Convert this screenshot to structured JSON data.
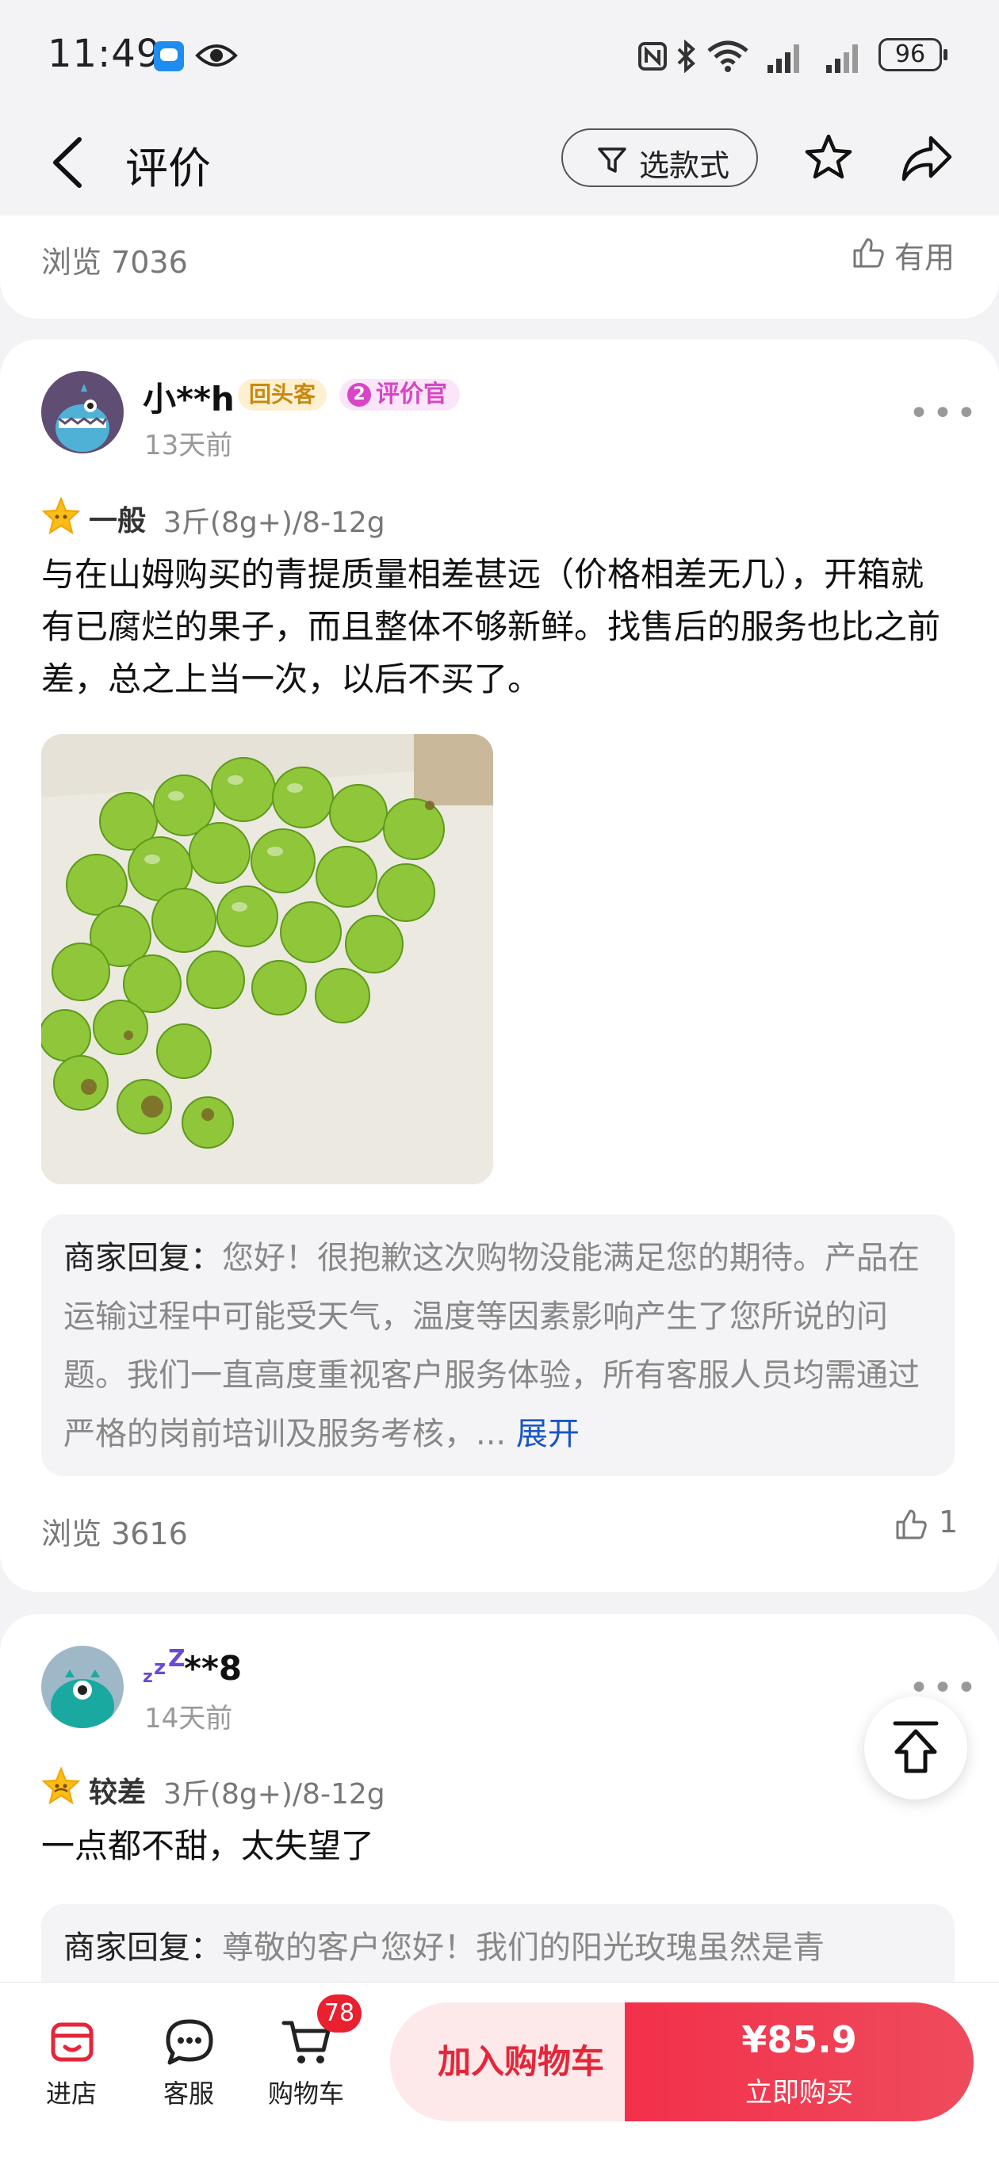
{
  "status_bar": {
    "time": "11:49",
    "battery": "96"
  },
  "header": {
    "title": "评价",
    "filter_label": "选款式"
  },
  "top_card": {
    "views": "浏览 7036",
    "helpful_label": "有用"
  },
  "review1": {
    "username": "小**h",
    "badge_returning": "回头客",
    "badge_reviewer": "评价官",
    "time_ago": "13天前",
    "rating_label": "一般",
    "spec": "3斤(8g+)/8-12g",
    "text": "与在山姆购买的青提质量相差甚远（价格相差无几），开箱就有已腐烂的果子，而且整体不够新鲜。找售后的服务也比之前差，总之上当一次，以后不买了。",
    "reply_label": "商家回复：",
    "reply_text": "您好！很抱歉这次购物没能满足您的期待。产品在运输过程中可能受天气，温度等因素影响产生了您所说的问题。我们一直高度重视客户服务体验，所有客服人员均需通过严格的岗前培训及服务考核，...",
    "expand_label": "展开",
    "views": "浏览 3616",
    "likes": "1"
  },
  "review2": {
    "username": "**8",
    "time_ago": "14天前",
    "rating_label": "较差",
    "spec": "3斤(8g+)/8-12g",
    "text": "一点都不甜，太失望了",
    "reply_label": "商家回复：",
    "reply_text": "尊敬的客户您好！我们的阳光玫瑰虽然是青"
  },
  "bottom_bar": {
    "store_label": "进店",
    "service_label": "客服",
    "cart_label": "购物车",
    "cart_count": "78",
    "add_cart_label": "加入购物车",
    "price": "¥85.9",
    "buy_label": "立即购买"
  },
  "colors": {
    "accent": "#e8202f",
    "link": "#1a56c5"
  }
}
